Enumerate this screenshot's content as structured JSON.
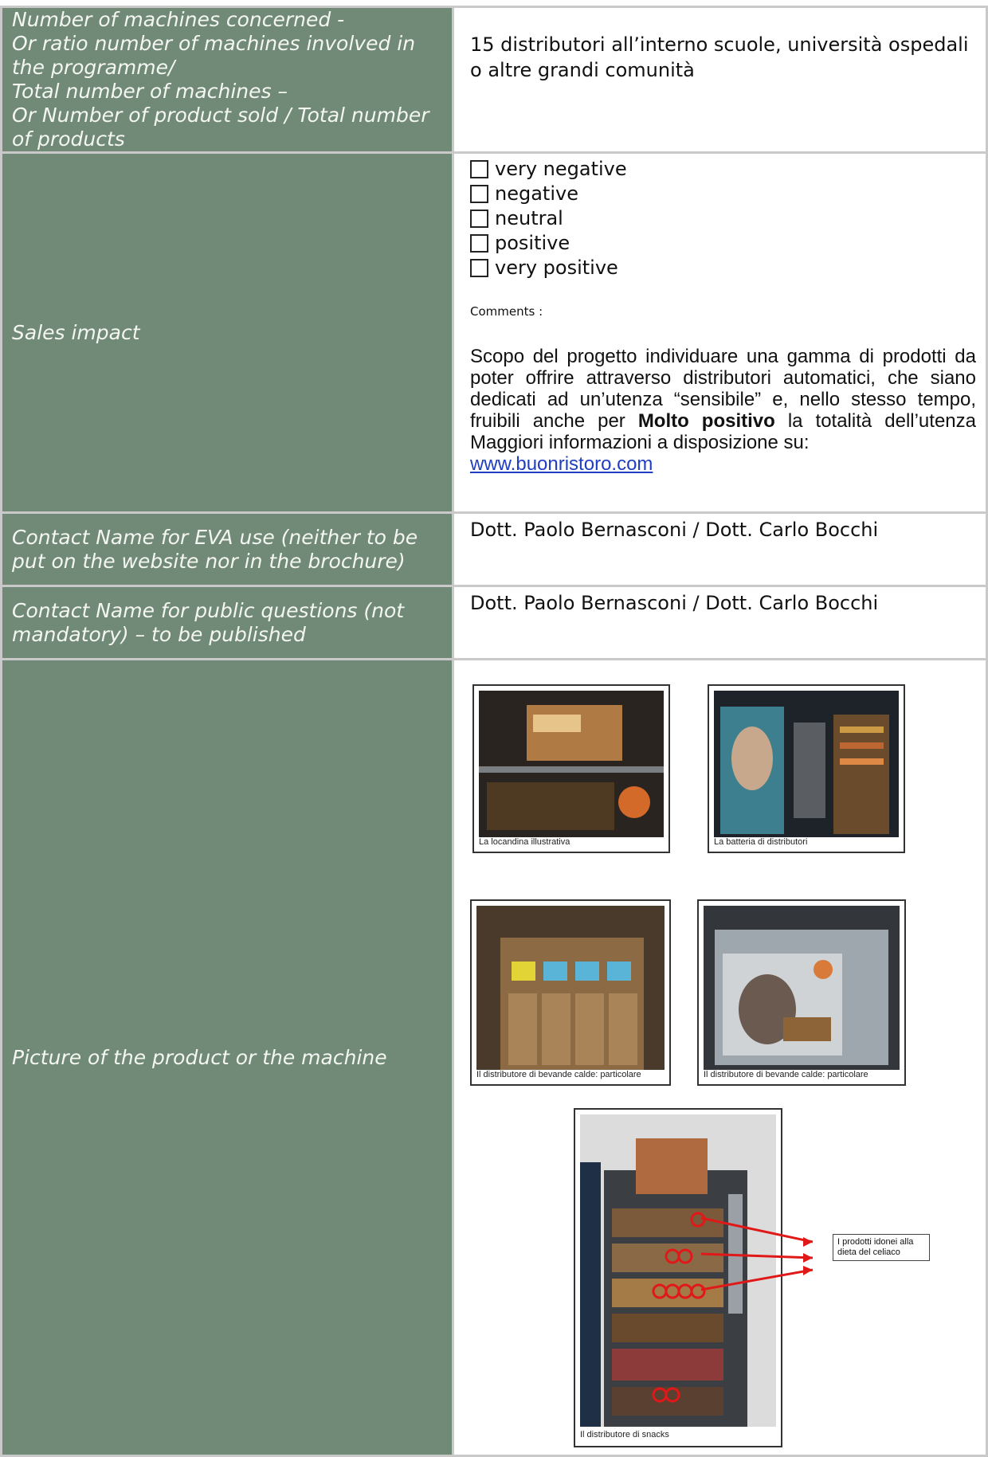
{
  "rows": {
    "machines": {
      "label": "Number of machines concerned -\nOr ratio number of machines involved in the programme/\nTotal number of machines –\nOr Number of product sold / Total number of products",
      "value": "15 distributori all’interno scuole, università ospedali o altre grandi comunità"
    },
    "sales": {
      "label": "Sales impact",
      "options": [
        "very negative",
        "negative",
        "neutral",
        "positive",
        "very positive"
      ],
      "comments_label": "Comments :",
      "comment_text_before": "Scopo del progetto individuare una gamma di prodotti da poter offrire attraverso distributori automatici, che siano dedicati ad un’utenza “sensibile” e, nello stesso tempo, fruibili anche per ",
      "comment_bold": "Molto positivo",
      "comment_text_after": " la totalità dell’utenza Maggiori informazioni a disposizione su:",
      "link": "www.buonristoro.com"
    },
    "contact_eva": {
      "label": "Contact Name for EVA use (neither to be put on the website nor in the brochure)",
      "value": "Dott. Paolo Bernasconi / Dott. Carlo Bocchi"
    },
    "contact_public": {
      "label": "Contact Name for public questions (not mandatory) – to be published",
      "value": "Dott. Paolo Bernasconi / Dott. Carlo Bocchi"
    },
    "picture": {
      "label": "Picture of the product or the machine",
      "captions": [
        "La locandina illustrativa",
        "La batteria di distributori",
        "Il distributore di bevande calde: particolare",
        "Il distributore di bevande calde: particolare",
        "Il distributore di snacks"
      ],
      "note": "I prodotti idonei alla dieta del celiaco"
    }
  },
  "colors": {
    "label_bg": "#718a77",
    "link": "#1f3ec2"
  }
}
